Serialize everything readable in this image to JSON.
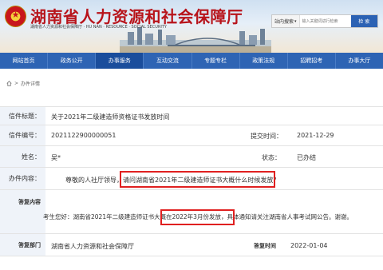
{
  "site": {
    "title": "湖南省人力资源和社会保障厅",
    "subtitle": "湖南省人力资源和社会保障厅 · HU NAN · RESOURCE · SOCIAL SECURITY",
    "search": {
      "scope": "站内搜索",
      "placeholder": "输入关键词进行检索",
      "button": "检 索"
    }
  },
  "nav": [
    "网站首页",
    "政务公开",
    "办事服务",
    "互动交流",
    "专题专栏",
    "政策法规",
    "招聘招考",
    "办事大厅"
  ],
  "breadcrumb": {
    "separator": ">",
    "current": "办件详情"
  },
  "detail": {
    "title_label": "信件标题：",
    "title_value": "关于2021年二级建造师资格证书发放时间",
    "code_label": "信件编号：",
    "code_value": "2021122900000051",
    "submit_label": "提交时间：",
    "submit_value": "2021-12-29",
    "name_label": "姓名：",
    "name_value": "吴*",
    "status_label": "状态：",
    "status_value": "已办结",
    "content_label": "办件内容：",
    "content_prefix": "尊敬的人社厅领导，",
    "content_highlight": "请问湖南省2021年二级建造师证书大概什么时候发放",
    "content_suffix": "？",
    "reply_label": "答复内容",
    "reply_p1": "考生您好：湖南省2021年二级建造师证书",
    "reply_highlight": "大概在2022年3月份发放",
    "reply_p2": "，具体通知请关注湖南省人事考试网公告。谢谢。",
    "dept_label": "答复部门",
    "dept_value": "湖南省人力资源和社会保障厅",
    "time_label": "答复时间",
    "time_value": "2022-01-04"
  }
}
